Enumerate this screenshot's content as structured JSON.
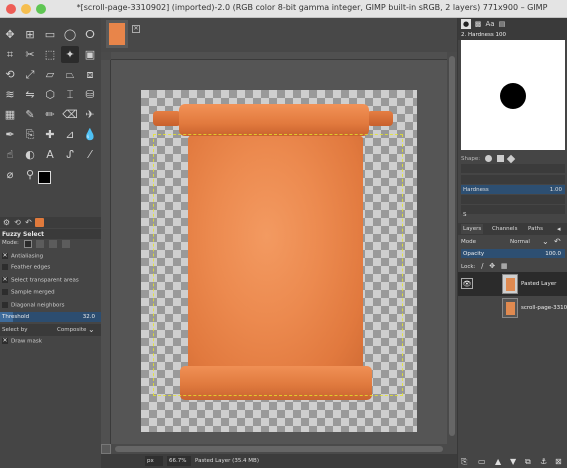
{
  "window": {
    "title": "*[scroll-page-3310902] (imported)-2.0 (RGB color 8-bit gamma integer, GIMP built-in sRGB, 2 layers) 771x900 – GIMP"
  },
  "toolbox": {
    "tools": [
      {
        "name": "move-tool-icon",
        "glyph": "✥"
      },
      {
        "name": "align-tool-icon",
        "glyph": "⊞"
      },
      {
        "name": "rect-select-icon",
        "glyph": "▭"
      },
      {
        "name": "ellipse-select-icon",
        "glyph": "◯"
      },
      {
        "name": "free-select-icon",
        "glyph": "ⵔ"
      },
      {
        "name": "crop-tool-icon",
        "glyph": "⌗"
      },
      {
        "name": "scissors-select-icon",
        "glyph": "✂"
      },
      {
        "name": "foreground-select-icon",
        "glyph": "⬚"
      },
      {
        "name": "fuzzy-select-icon",
        "glyph": "✦"
      },
      {
        "name": "color-select-icon",
        "glyph": "▣"
      },
      {
        "name": "rotate-tool-icon",
        "glyph": "⟲"
      },
      {
        "name": "scale-tool-icon",
        "glyph": "⤢"
      },
      {
        "name": "shear-tool-icon",
        "glyph": "▱"
      },
      {
        "name": "perspective-tool-icon",
        "glyph": "⏢"
      },
      {
        "name": "3d-transform-icon",
        "glyph": "⧈"
      },
      {
        "name": "warp-transform-icon",
        "glyph": "≋"
      },
      {
        "name": "flip-tool-icon",
        "glyph": "⇋"
      },
      {
        "name": "cage-transform-icon",
        "glyph": "⬡"
      },
      {
        "name": "text-cursor-icon",
        "glyph": "⌶"
      },
      {
        "name": "bucket-fill-icon",
        "glyph": "⛁"
      },
      {
        "name": "gradient-tool-icon",
        "glyph": "▦"
      },
      {
        "name": "pencil-tool-icon",
        "glyph": "✎"
      },
      {
        "name": "paintbrush-tool-icon",
        "glyph": "✏"
      },
      {
        "name": "eraser-tool-icon",
        "glyph": "⌫"
      },
      {
        "name": "airbrush-tool-icon",
        "glyph": "✈"
      },
      {
        "name": "ink-tool-icon",
        "glyph": "✒"
      },
      {
        "name": "clone-tool-icon",
        "glyph": "⎘"
      },
      {
        "name": "heal-tool-icon",
        "glyph": "✚"
      },
      {
        "name": "perspective-clone-icon",
        "glyph": "⊿"
      },
      {
        "name": "blur-tool-icon",
        "glyph": "💧"
      },
      {
        "name": "smudge-tool-icon",
        "glyph": "☝"
      },
      {
        "name": "dodge-burn-icon",
        "glyph": "◐"
      },
      {
        "name": "text-tool-icon",
        "glyph": "A"
      },
      {
        "name": "paths-tool-icon",
        "glyph": "ᔑ"
      },
      {
        "name": "color-picker-icon",
        "glyph": "⁄"
      },
      {
        "name": "measure-tool-icon",
        "glyph": "⌀"
      },
      {
        "name": "zoom-tool-icon",
        "glyph": "⚲"
      }
    ],
    "tool_options": {
      "title": "Fuzzy Select",
      "mode_label": "Mode:",
      "antialiasing": "Antialiasing",
      "feather_edges": "Feather edges",
      "select_transparent": "Select transparent areas",
      "sample_merged": "Sample merged",
      "diagonal_neighbors": "Diagonal neighbors",
      "threshold_label": "Threshold",
      "threshold_value": "32.0",
      "threshold_fraction": 0.125,
      "select_by_label": "Select by",
      "select_by_value": "Composite",
      "draw_mask": "Draw mask"
    }
  },
  "canvas_status": {
    "unit": "px",
    "zoom": "66.7%",
    "layer_info": "Pasted Layer (35.4 MB)"
  },
  "brushes": {
    "brush_name": "2. Hardness 100",
    "shape_label": "Shape:",
    "hardness_label": "Hardness",
    "hardness_value": "1.00",
    "spacing_label": "S"
  },
  "layers": {
    "tab_layers": "Layers",
    "tab_channels": "Channels",
    "tab_paths": "Paths",
    "mode_label": "Mode",
    "mode_value": "Normal",
    "opacity_label": "Opacity",
    "opacity_value": "100.0",
    "lock_label": "Lock:",
    "items": [
      {
        "name": "Pasted Layer"
      },
      {
        "name": "scroll-page-331090"
      }
    ]
  },
  "colors": {
    "accent": "#e07a3c",
    "selection_blue": "#2d4f72",
    "paper_orange": "#ec8a4f"
  }
}
